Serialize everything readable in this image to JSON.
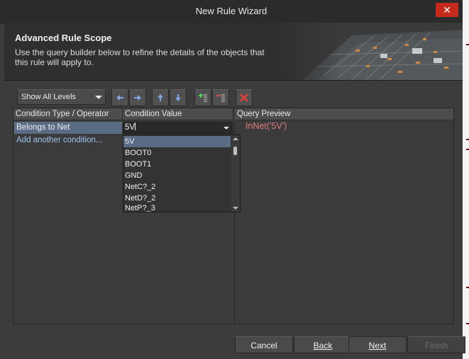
{
  "window": {
    "title": "New Rule Wizard",
    "close_glyph": "✕"
  },
  "banner": {
    "heading": "Advanced Rule Scope",
    "description": "Use the query builder below to refine the details of the objects that this rule will apply to."
  },
  "toolbar": {
    "levels_value": "Show All Levels",
    "buttons": [
      "arrow-left-icon",
      "arrow-right-icon",
      "arrow-up-icon",
      "arrow-down-icon",
      "add-condition-icon",
      "remove-condition-icon",
      "delete-icon"
    ]
  },
  "grid": {
    "headers": {
      "condition_type": "Condition Type / Operator",
      "condition_value": "Condition Value",
      "query_preview": "Query Preview"
    },
    "row": {
      "type": "Belongs to Net",
      "value": "5V"
    },
    "add_condition": "Add another condition...",
    "dropdown_items": [
      "5V",
      "BOOT0",
      "BOOT1",
      "GND",
      "NetC?_2",
      "NetD?_2",
      "NetP?_3"
    ],
    "dropdown_selected": "5V",
    "query": "InNet('5V')"
  },
  "footer": {
    "cancel": "Cancel",
    "back": "Back",
    "next": "Next",
    "finish": "Finish"
  },
  "colors": {
    "accent_selection": "#5a6b84",
    "query_text": "#e07a7a",
    "link": "#9ec4ef",
    "close": "#c42b1c"
  }
}
